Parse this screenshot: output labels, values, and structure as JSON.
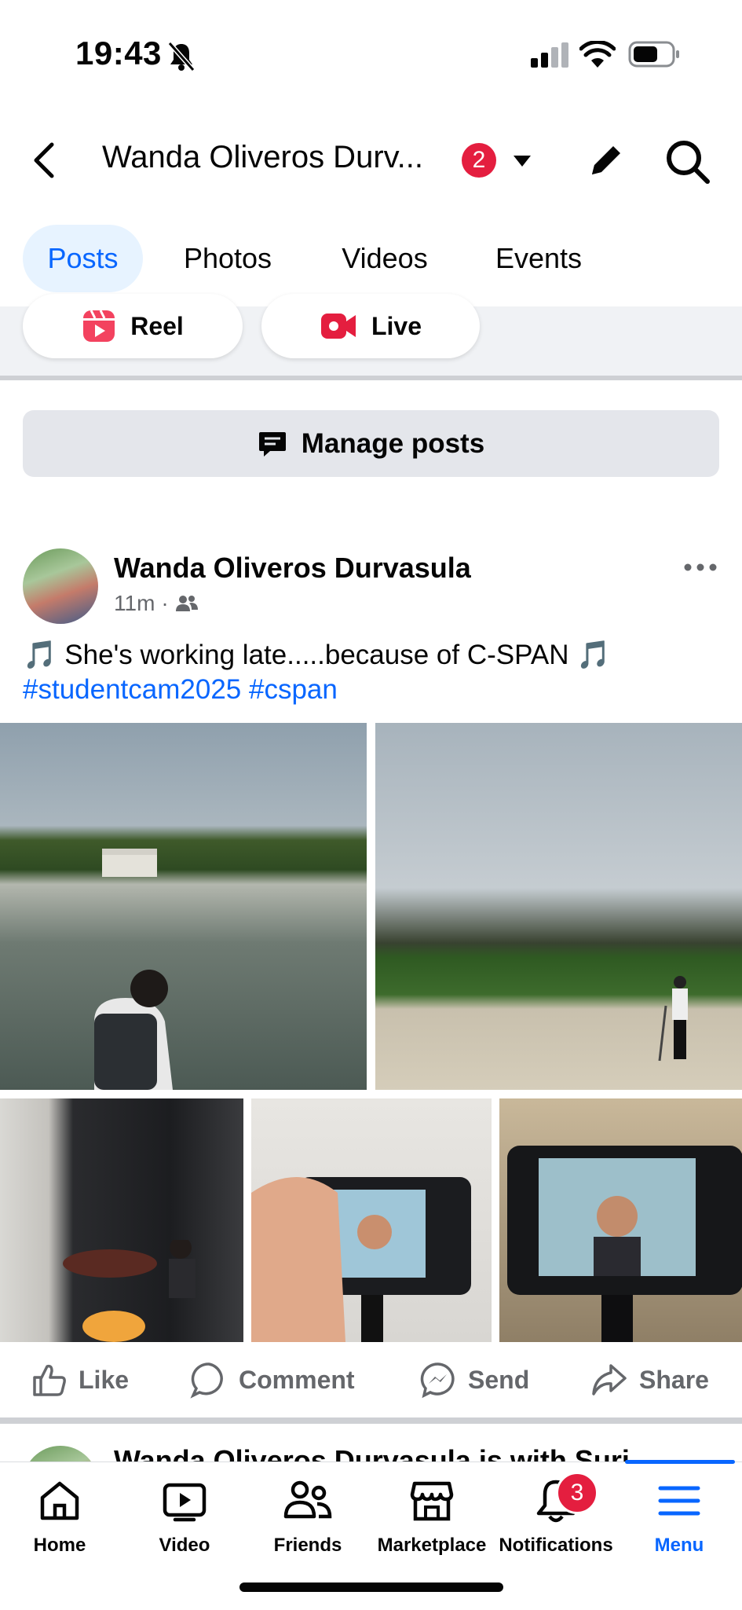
{
  "status": {
    "time": "19:43"
  },
  "header": {
    "title": "Wanda Oliveros Durv...",
    "badge_count": "2"
  },
  "tabs": [
    {
      "label": "Posts",
      "active": true
    },
    {
      "label": "Photos"
    },
    {
      "label": "Videos"
    },
    {
      "label": "Events"
    }
  ],
  "create": {
    "reel_label": "Reel",
    "live_label": "Live"
  },
  "manage_posts_label": "Manage posts",
  "post": {
    "author": "Wanda Oliveros Durvasula",
    "time": "11m",
    "text_line1": "🎵 She's working late.....because of C-SPAN 🎵",
    "hashtags": "#studentcam2025 #cspan",
    "photo_icons": [
      "lincoln-memorial-reflecting-pool-photo",
      "national-mall-tripod-photo",
      "studio-setup-photo",
      "camera-screen-hand-photo",
      "camera-screen-closeup-photo"
    ],
    "actions": {
      "like": "Like",
      "comment": "Comment",
      "send": "Send",
      "share": "Share"
    }
  },
  "next_post_preview": {
    "text": "Wanda Oliveros Durvasula is with Suri"
  },
  "bottom_nav": {
    "home": "Home",
    "video": "Video",
    "friends": "Friends",
    "marketplace": "Marketplace",
    "notifications": "Notifications",
    "notifications_badge": "3",
    "menu": "Menu"
  },
  "colors": {
    "accent": "#0866ff",
    "badge": "#e41e3f",
    "tab_active_bg": "#e7f3ff"
  }
}
